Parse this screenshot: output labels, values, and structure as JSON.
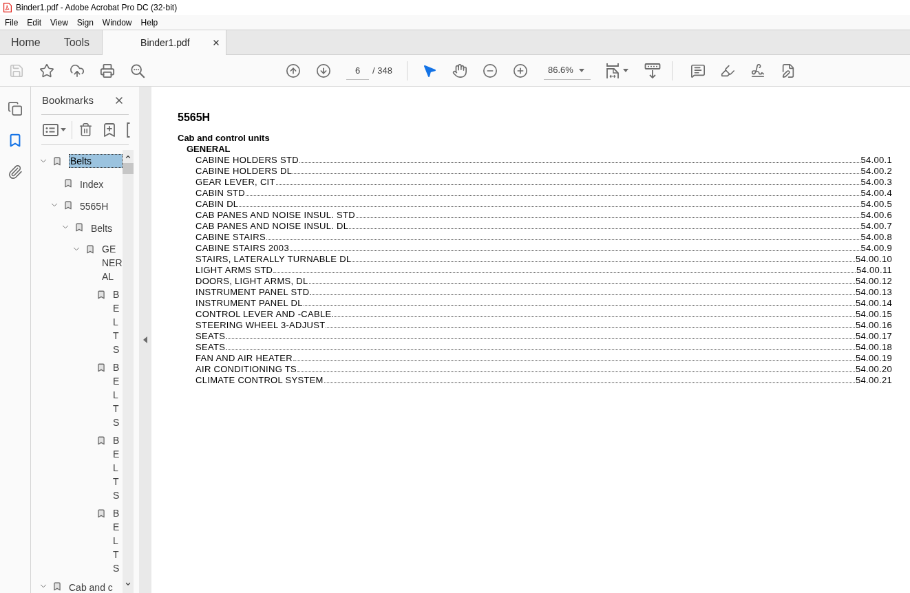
{
  "window": {
    "title": "Binder1.pdf - Adobe Acrobat Pro DC (32-bit)"
  },
  "menu": [
    "File",
    "Edit",
    "View",
    "Sign",
    "Window",
    "Help"
  ],
  "tabs": [
    {
      "label": "Home",
      "selected": false,
      "kind": "nav"
    },
    {
      "label": "Tools",
      "selected": false,
      "kind": "nav"
    },
    {
      "label": "Binder1.pdf",
      "selected": true,
      "kind": "document"
    }
  ],
  "toolbar": {
    "save": {
      "disabled": true
    },
    "page_field": {
      "value": "6"
    },
    "page_count": "/ 348",
    "tools": [
      {
        "kind": "select",
        "selected": true
      },
      {
        "kind": "hand",
        "selected": false
      }
    ],
    "zoom_field": {
      "value": "86.6%"
    }
  },
  "side_rail": [
    {
      "kind": "pages",
      "selected": false
    },
    {
      "kind": "bookmarks",
      "selected": true
    },
    {
      "kind": "attachments",
      "selected": false
    }
  ],
  "bookmarks_panel": {
    "title": "Bookmarks",
    "tree": [
      {
        "label": "Belts",
        "selected": true,
        "expanded": true,
        "children": [
          {
            "label": "Index",
            "selected": false
          },
          {
            "label": "5565H",
            "selected": false,
            "expanded": true,
            "children": [
              {
                "label": "Belts",
                "selected": false,
                "expanded": true,
                "children": [
                  {
                    "label": "GENERAL",
                    "selected": false,
                    "expanded": true,
                    "children": [
                      {
                        "label": "BELTS",
                        "selected": false
                      },
                      {
                        "label": "BELTS",
                        "selected": false
                      },
                      {
                        "label": "BELTS",
                        "selected": false
                      },
                      {
                        "label": "BELTS",
                        "selected": false
                      }
                    ]
                  }
                ]
              }
            ]
          }
        ]
      },
      {
        "label": "Cab and c",
        "selected": false,
        "expanded": true
      }
    ]
  },
  "document": {
    "heading": "5565H",
    "section": "Cab and control units",
    "subsection": "GENERAL",
    "entries": [
      {
        "title": "CABINE HOLDERS STD",
        "page": "54.00.1"
      },
      {
        "title": "CABINE HOLDERS DL",
        "page": "54.00.2"
      },
      {
        "title": "GEAR LEVER, CIT",
        "page": "54.00.3"
      },
      {
        "title": "CABIN STD",
        "page": "54.00.4"
      },
      {
        "title": "CABIN DL",
        "page": "54.00.5"
      },
      {
        "title": "CAB PANES AND NOISE INSUL. STD",
        "page": "54.00.6"
      },
      {
        "title": "CAB PANES AND NOISE INSUL. DL",
        "page": "54.00.7"
      },
      {
        "title": "CABINE STAIRS",
        "page": "54.00.8"
      },
      {
        "title": "CABINE STAIRS 2003",
        "page": "54.00.9"
      },
      {
        "title": "STAIRS, LATERALLY TURNABLE DL",
        "page": "54.00.10"
      },
      {
        "title": "LIGHT ARMS STD",
        "page": "54.00.11"
      },
      {
        "title": "DOORS, LIGHT ARMS, DL",
        "page": "54.00.12"
      },
      {
        "title": "INSTRUMENT PANEL STD",
        "page": "54.00.13"
      },
      {
        "title": "INSTRUMENT PANEL DL",
        "page": "54.00.14"
      },
      {
        "title": "CONTROL LEVER AND -CABLE",
        "page": "54.00.15"
      },
      {
        "title": "STEERING WHEEL 3-ADJUST",
        "page": "54.00.16"
      },
      {
        "title": "SEATS",
        "page": "54.00.17"
      },
      {
        "title": "SEATS",
        "page": "54.00.18"
      },
      {
        "title": "FAN AND AIR HEATER",
        "page": "54.00.19"
      },
      {
        "title": "AIR CONDITIONING TS",
        "page": "54.00.20"
      },
      {
        "title": "CLIMATE CONTROL SYSTEM",
        "page": "54.00.21"
      }
    ]
  }
}
